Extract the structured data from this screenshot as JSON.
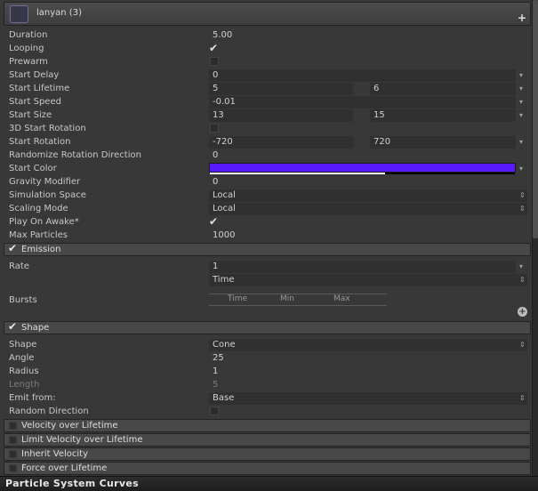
{
  "header": {
    "title": "lanyan (3)",
    "add_label": "+"
  },
  "main_module": {
    "duration": {
      "label": "Duration",
      "value": "5.00"
    },
    "looping": {
      "label": "Looping",
      "checked": true
    },
    "prewarm": {
      "label": "Prewarm",
      "checked": false
    },
    "start_delay": {
      "label": "Start Delay",
      "value": "0"
    },
    "start_lifetime": {
      "label": "Start Lifetime",
      "min": "5",
      "max": "6"
    },
    "start_speed": {
      "label": "Start Speed",
      "value": "-0.01"
    },
    "start_size": {
      "label": "Start Size",
      "min": "13",
      "max": "15"
    },
    "start_3d_rotation": {
      "label": "3D Start Rotation",
      "checked": false
    },
    "start_rotation": {
      "label": "Start Rotation",
      "min": "-720",
      "max": "720"
    },
    "randomize_rotation": {
      "label": "Randomize Rotation Direction",
      "value": "0"
    },
    "start_color": {
      "label": "Start Color",
      "color": "#5a1aff"
    },
    "gravity": {
      "label": "Gravity Modifier",
      "value": "0"
    },
    "simulation_space": {
      "label": "Simulation Space",
      "value": "Local"
    },
    "scaling_mode": {
      "label": "Scaling Mode",
      "value": "Local"
    },
    "play_on_awake": {
      "label": "Play On Awake*",
      "checked": true
    },
    "max_particles": {
      "label": "Max Particles",
      "value": "1000"
    }
  },
  "emission": {
    "title": "Emission",
    "enabled": true,
    "rate": {
      "label": "Rate",
      "value": "1",
      "mode": "Time"
    },
    "bursts": {
      "label": "Bursts",
      "columns": [
        "Time",
        "Min",
        "Max"
      ]
    }
  },
  "shape": {
    "title": "Shape",
    "enabled": true,
    "shape": {
      "label": "Shape",
      "value": "Cone"
    },
    "angle": {
      "label": "Angle",
      "value": "25"
    },
    "radius": {
      "label": "Radius",
      "value": "1"
    },
    "length": {
      "label": "Length",
      "value": "5"
    },
    "emit_from": {
      "label": "Emit from:",
      "value": "Base"
    },
    "random_direction": {
      "label": "Random Direction",
      "checked": false
    }
  },
  "collapsed_modules": [
    {
      "title": "Velocity over Lifetime",
      "enabled": false
    },
    {
      "title": "Limit Velocity over Lifetime",
      "enabled": false
    },
    {
      "title": "Inherit Velocity",
      "enabled": false
    },
    {
      "title": "Force over Lifetime",
      "enabled": false
    }
  ],
  "footer": {
    "title": "Particle System Curves"
  },
  "icons": {
    "check": "✔",
    "dropdown": "▾",
    "updown": "⇕",
    "add": "+"
  }
}
